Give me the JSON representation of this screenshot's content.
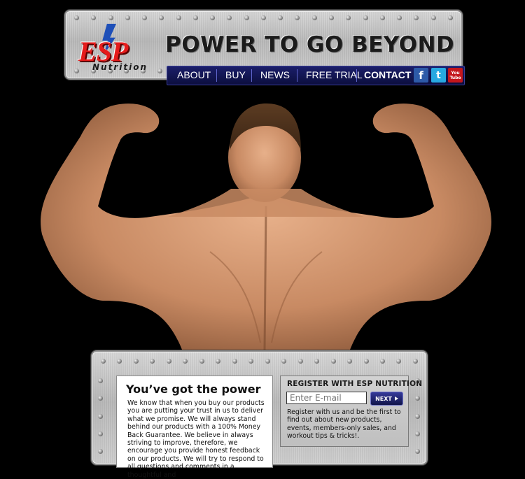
{
  "header": {
    "logo": {
      "brand": "ESP",
      "sub": "Nutrition"
    },
    "tagline": "POWER TO GO BEYOND"
  },
  "nav": {
    "items": [
      {
        "label": "ABOUT"
      },
      {
        "label": "BUY"
      },
      {
        "label": "NEWS"
      },
      {
        "label": "FREE TRIAL"
      },
      {
        "label": "CONTACT"
      }
    ],
    "social": {
      "facebook": "f",
      "twitter": "t",
      "youtube_top": "You",
      "youtube_bottom": "Tube"
    }
  },
  "power": {
    "title": "You’ve got the power",
    "body": "We know that when you buy our products you are putting your trust in us to deliver what we promise. We will always stand behind our products with a 100% Money Back Guarantee. We believe in always striving to improve, therefore, we encourage you provide honest feedback on our products. We will try to respond to all questions and comments in a thoughtful and"
  },
  "register": {
    "title": "REGISTER WITH ESP NUTRITION",
    "email_placeholder": "Enter E-mail",
    "next_label": "NEXT",
    "body": "Register with us and be the first to find out about new products, events, members-only sales, and workout tips & tricks!."
  },
  "colors": {
    "background": "#000000",
    "nav": "#14175a",
    "accent_red": "#e51b1b",
    "accent_blue": "#1e4fb8"
  }
}
